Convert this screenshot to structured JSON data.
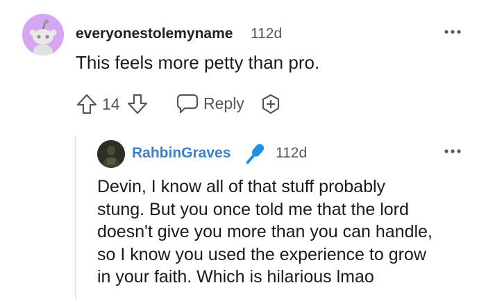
{
  "comment": {
    "username": "everyonestolemyname",
    "time": "112d",
    "body": "This feels more petty than pro.",
    "avatar_color": "#d7a6f2",
    "actions": {
      "upvote_icon": "arrow-up-outline-icon",
      "vote_count": "14",
      "downvote_icon": "arrow-down-outline-icon",
      "reply_icon": "speech-bubble-icon",
      "reply_label": "Reply",
      "award_icon": "award-plus-icon"
    },
    "more_icon": "ellipsis-icon"
  },
  "reply": {
    "username": "RahbinGraves",
    "username_color": "#3d7fc8",
    "badge_icon": "microphone-icon",
    "badge_color": "#1e8fe6",
    "time": "112d",
    "body_lines": [
      "Devin, I know all of that stuff probably",
      "stung. But you once told me that the lord",
      "doesn't give you more than you can handle,",
      "so I know you used the experience to grow",
      "in your faith. Which is hilarious lmao"
    ],
    "more_icon": "ellipsis-icon"
  }
}
